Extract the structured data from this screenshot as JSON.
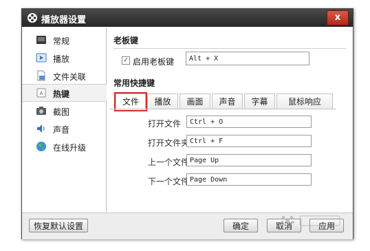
{
  "window": {
    "title": "播放器设置",
    "close_label": "x"
  },
  "sidebar": {
    "items": [
      {
        "label": "常规",
        "icon": "general-icon"
      },
      {
        "label": "播放",
        "icon": "play-icon"
      },
      {
        "label": "文件关联",
        "icon": "file-association-icon"
      },
      {
        "label": "热键",
        "icon": "hotkey-icon",
        "active": true
      },
      {
        "label": "截图",
        "icon": "camera-icon"
      },
      {
        "label": "声音",
        "icon": "speaker-icon"
      },
      {
        "label": "在线升级",
        "icon": "globe-icon"
      }
    ]
  },
  "boss_key": {
    "title": "老板键",
    "checkbox_checked": true,
    "checkbox_label": "启用老板键",
    "value": "Alt + X"
  },
  "shortcuts": {
    "title": "常用快捷键",
    "tabs": [
      "文件",
      "播放",
      "画面",
      "声音",
      "字幕",
      "鼠标响应"
    ],
    "active_tab": "文件",
    "rows": [
      {
        "label": "打开文件",
        "value": "Ctrl + O"
      },
      {
        "label": "打开文件夹",
        "value": "Ctrl + F"
      },
      {
        "label": "上一个文件",
        "value": "Page Up"
      },
      {
        "label": "下一个文件",
        "value": "Page Down"
      }
    ]
  },
  "footer": {
    "restore_label": "恢复默认设置",
    "ok_label": "确定",
    "cancel_label": "取消",
    "apply_label": "应用"
  },
  "colors": {
    "titlebar": "#2f2f2f",
    "highlight": "#d6282a",
    "close": "#c0392b"
  }
}
